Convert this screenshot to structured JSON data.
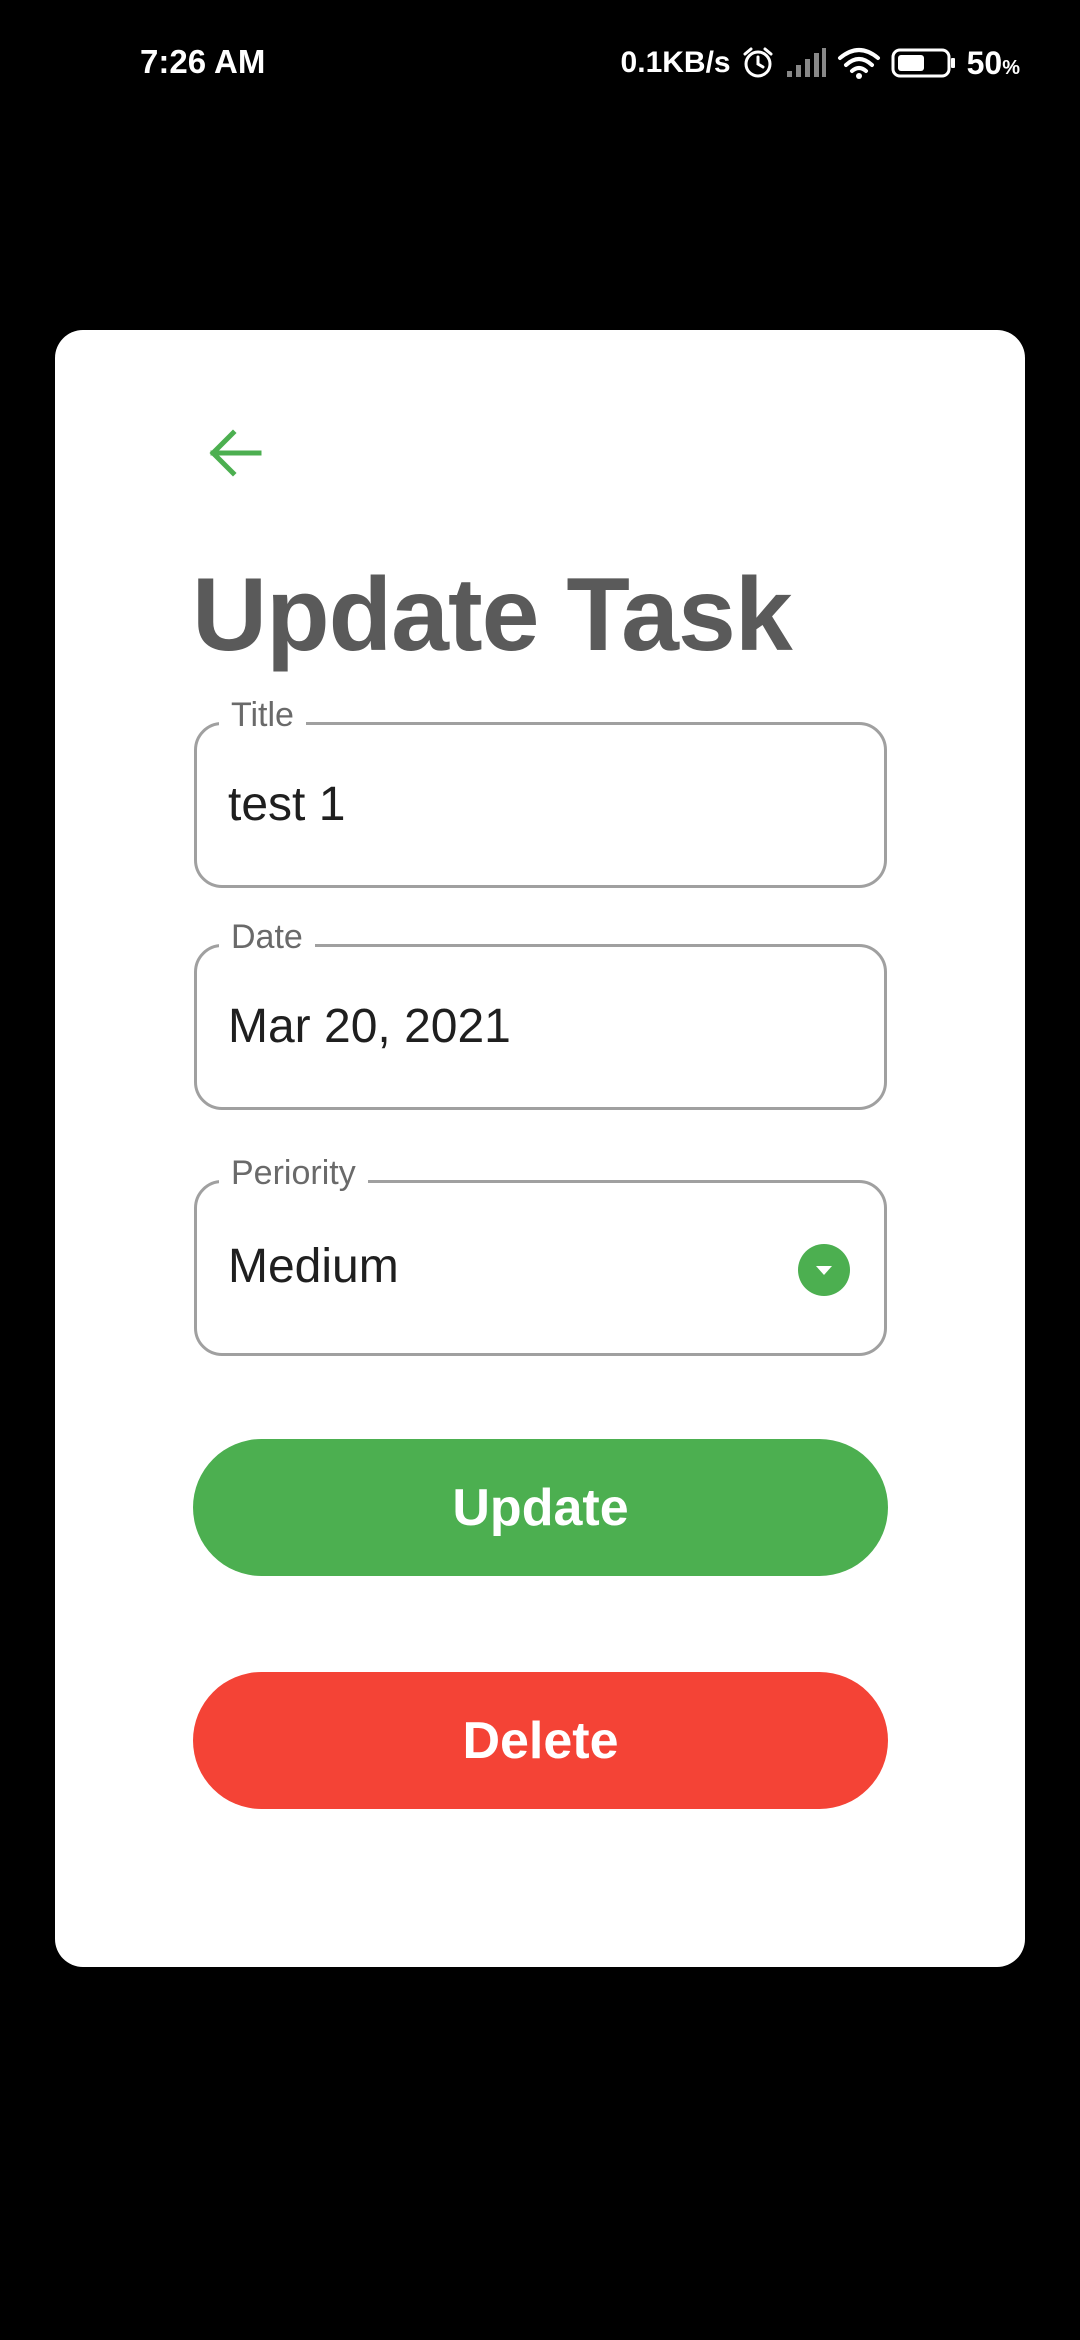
{
  "status_bar": {
    "time": "7:26 AM",
    "speed": "0.1KB/s",
    "battery_pct": "50",
    "battery_unit": "%",
    "icons": [
      "alarm-icon",
      "signal-icon",
      "wifi-icon",
      "battery-icon"
    ]
  },
  "header": {
    "title": "Update Task",
    "back_icon": "arrow-left-icon"
  },
  "form": {
    "title": {
      "label": "Title",
      "value": "test 1"
    },
    "date": {
      "label": "Date",
      "value": "Mar 20, 2021"
    },
    "priority": {
      "label": "Periority",
      "value": "Medium",
      "icon": "chevron-down-icon"
    }
  },
  "actions": {
    "update_label": "Update",
    "delete_label": "Delete"
  },
  "colors": {
    "accent": "#4caf50",
    "danger": "#f44336",
    "title_text": "#5a5a5a",
    "background": "#000000",
    "card": "#ffffff"
  }
}
